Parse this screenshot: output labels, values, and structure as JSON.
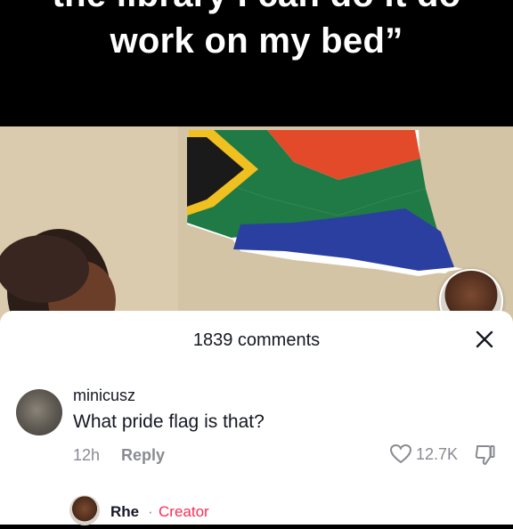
{
  "caption": {
    "line1": "the library I can do it do",
    "line2": "work on my bed”"
  },
  "sheet": {
    "comments_count": "1839 comments",
    "close_icon": "close-icon"
  },
  "comment": {
    "username": "minicusz",
    "text": "What pride flag is that?",
    "time": "12h",
    "reply_label": "Reply",
    "like_count": "12.7K",
    "like_icon": "heart-outline-icon",
    "dislike_icon": "thumbs-down-icon"
  },
  "reply_preview": {
    "username": "Rhe",
    "separator": "·",
    "badge": "Creator"
  },
  "colors": {
    "accent_red": "#fe2c55",
    "text_primary": "#161823",
    "text_secondary": "#8a8b91"
  }
}
